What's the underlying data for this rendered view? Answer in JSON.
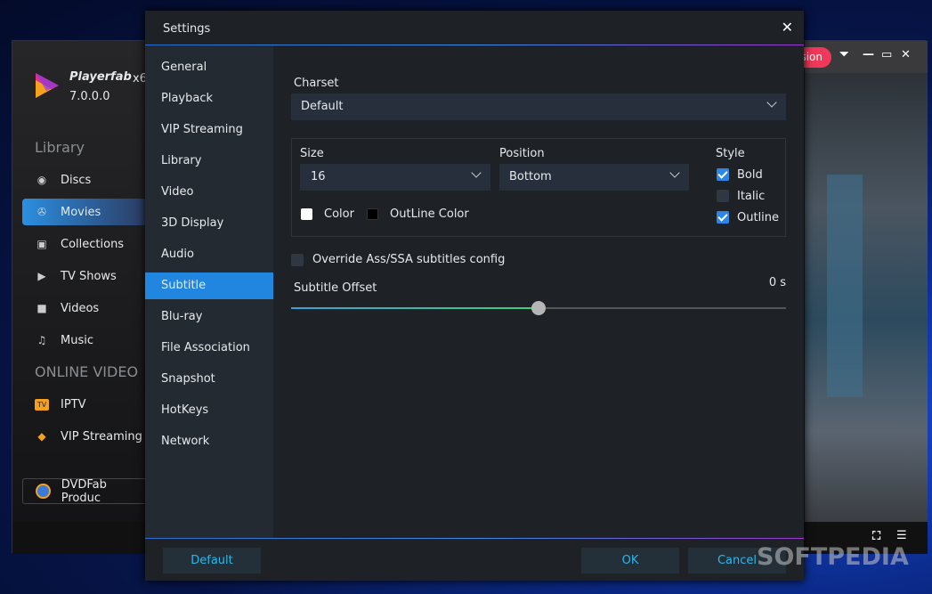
{
  "app": {
    "brand": "Playerfab",
    "brand_suffix": "x6",
    "version": "7.0.0.0",
    "upgrade_pill": "sion",
    "sections": [
      "Library",
      "ONLINE VIDEO"
    ],
    "library_items": [
      {
        "label": "Discs",
        "icon": "disc-icon"
      },
      {
        "label": "Movies",
        "icon": "film-reel-icon",
        "active": true
      },
      {
        "label": "Collections",
        "icon": "collections-icon"
      },
      {
        "label": "TV Shows",
        "icon": "tv-icon"
      },
      {
        "label": "Videos",
        "icon": "video-camera-icon"
      },
      {
        "label": "Music",
        "icon": "music-note-icon"
      }
    ],
    "online_items": [
      {
        "label": "IPTV",
        "icon": "iptv-icon"
      },
      {
        "label": "VIP Streaming",
        "icon": "diamond-icon"
      }
    ],
    "dvdfab": "DVDFab Produc"
  },
  "settings": {
    "title": "Settings",
    "nav": [
      "General",
      "Playback",
      "VIP Streaming",
      "Library",
      "Video",
      "3D Display",
      "Audio",
      "Subtitle",
      "Blu-ray",
      "File Association",
      "Snapshot",
      "HotKeys",
      "Network"
    ],
    "active_nav": "Subtitle",
    "charset": {
      "label": "Charset",
      "value": "Default"
    },
    "size": {
      "label": "Size",
      "value": "16"
    },
    "position": {
      "label": "Position",
      "value": "Bottom"
    },
    "style": {
      "label": "Style",
      "options": [
        {
          "label": "Bold",
          "checked": true
        },
        {
          "label": "Italic",
          "checked": false
        },
        {
          "label": "Outline",
          "checked": true
        }
      ]
    },
    "color_label": "Color",
    "color_value": "#ffffff",
    "outline_color_label": "OutLine Color",
    "outline_color_value": "#000000",
    "override": {
      "label": "Override Ass/SSA subtitles config",
      "checked": false
    },
    "offset": {
      "label": "Subtitle Offset",
      "value_text": "0 s",
      "slider_fraction": 0.5
    },
    "buttons": {
      "default": "Default",
      "ok": "OK",
      "cancel": "Cancel"
    }
  },
  "watermark": "SOFTPEDIA",
  "colors": {
    "accent": "#2186e0",
    "button_text": "#2fb6e8",
    "pill": "#f2385a"
  }
}
